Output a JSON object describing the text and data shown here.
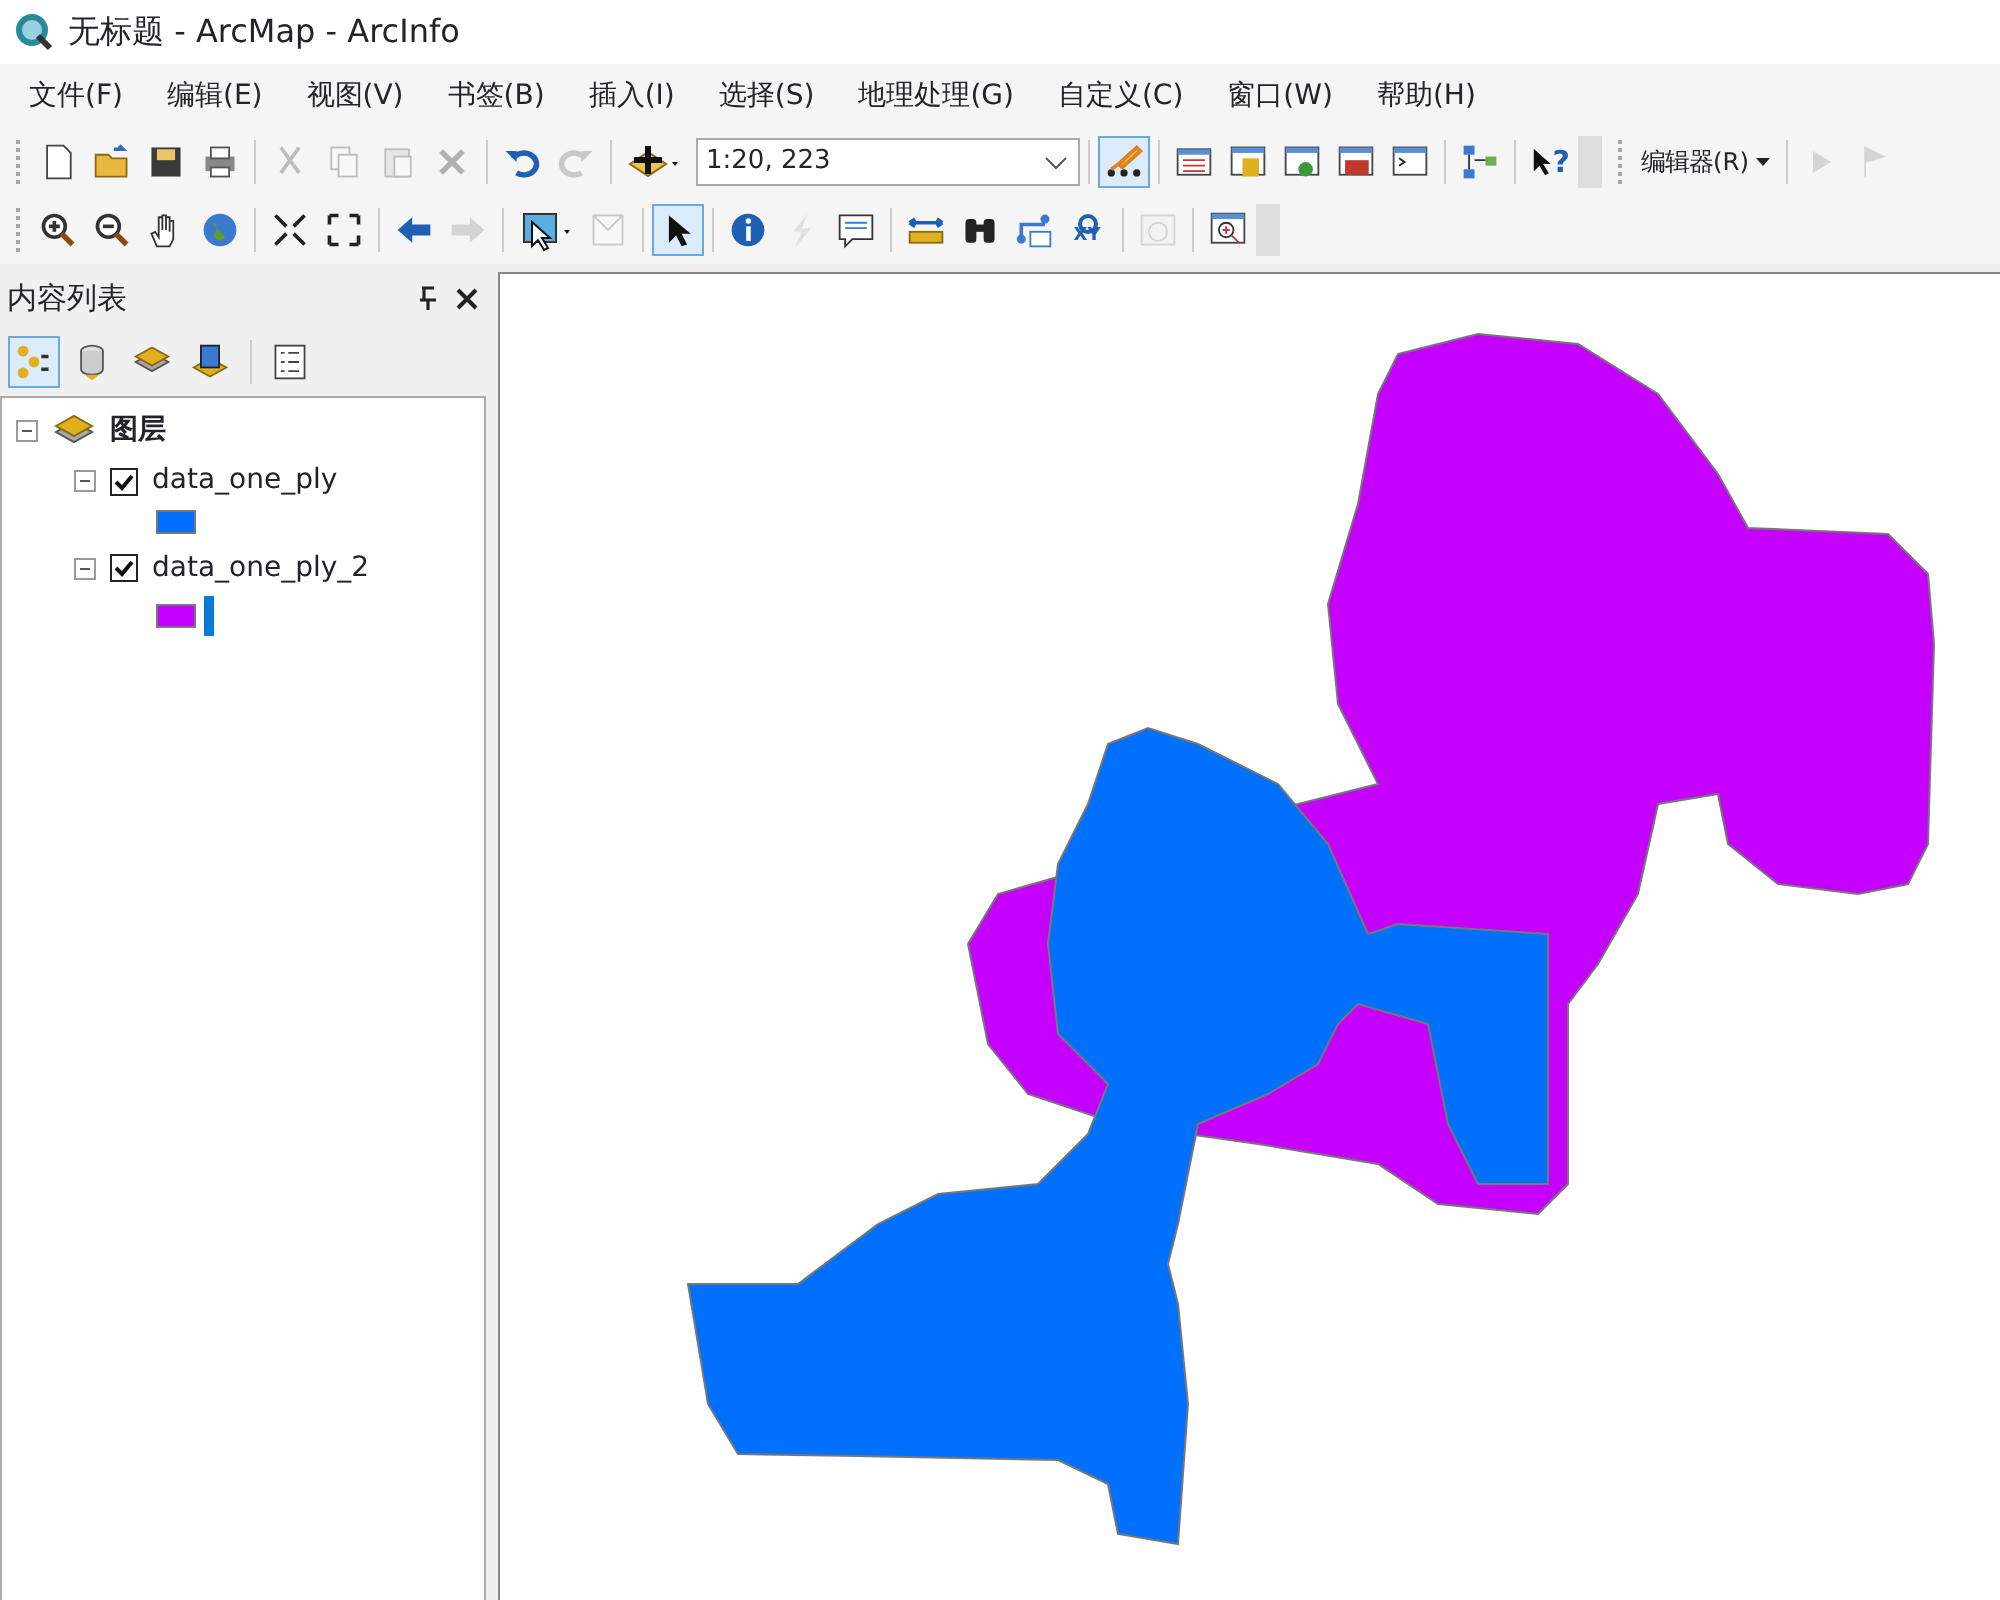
{
  "window": {
    "title": "无标题 - ArcMap - ArcInfo"
  },
  "menu": [
    "文件(F)",
    "编辑(E)",
    "视图(V)",
    "书签(B)",
    "插入(I)",
    "选择(S)",
    "地理处理(G)",
    "自定义(C)",
    "窗口(W)",
    "帮助(H)"
  ],
  "toolbar_1": [
    {
      "kind": "new",
      "disabled": false
    },
    {
      "kind": "open",
      "disabled": false
    },
    {
      "kind": "save",
      "disabled": false
    },
    {
      "kind": "print",
      "disabled": false
    },
    {
      "kind": "sep"
    },
    {
      "kind": "cut",
      "disabled": true
    },
    {
      "kind": "copy",
      "disabled": true
    },
    {
      "kind": "paste",
      "disabled": true
    },
    {
      "kind": "delete",
      "disabled": true
    },
    {
      "kind": "sep"
    },
    {
      "kind": "undo",
      "disabled": false
    },
    {
      "kind": "redo",
      "disabled": true
    },
    {
      "kind": "sep"
    },
    {
      "kind": "adddata",
      "disabled": false
    }
  ],
  "scale": {
    "value": "1:20, 223"
  },
  "toolbar_1b": [
    {
      "kind": "editor",
      "disabled": false
    },
    {
      "kind": "sep"
    },
    {
      "kind": "table",
      "disabled": false
    },
    {
      "kind": "catalog",
      "disabled": false
    },
    {
      "kind": "search",
      "disabled": false
    },
    {
      "kind": "toolbox",
      "disabled": false
    },
    {
      "kind": "python",
      "disabled": false
    },
    {
      "kind": "sep"
    },
    {
      "kind": "model",
      "disabled": false
    },
    {
      "kind": "sep"
    },
    {
      "kind": "help",
      "disabled": false,
      "label": "?"
    }
  ],
  "editor_menu": {
    "label": "编辑器(R)"
  },
  "toolbar_1c": [
    {
      "kind": "sketch",
      "disabled": true
    },
    {
      "kind": "sketchtext",
      "disabled": true
    }
  ],
  "toolbar_2": [
    {
      "kind": "zoomin",
      "disabled": false
    },
    {
      "kind": "zoomout",
      "disabled": false
    },
    {
      "kind": "pan",
      "disabled": false
    },
    {
      "kind": "globe",
      "disabled": false
    },
    {
      "kind": "sep"
    },
    {
      "kind": "fixedin",
      "disabled": false
    },
    {
      "kind": "fixedout",
      "disabled": false
    },
    {
      "kind": "sep"
    },
    {
      "kind": "back",
      "disabled": false
    },
    {
      "kind": "forward",
      "disabled": true
    },
    {
      "kind": "sep"
    },
    {
      "kind": "selectfeat",
      "disabled": false
    },
    {
      "kind": "clearsel",
      "disabled": true
    },
    {
      "kind": "sep"
    },
    {
      "kind": "pointer",
      "disabled": false
    },
    {
      "kind": "sep"
    },
    {
      "kind": "identify",
      "disabled": false
    },
    {
      "kind": "hyperlink",
      "disabled": true
    },
    {
      "kind": "popup",
      "disabled": false
    },
    {
      "kind": "sep"
    },
    {
      "kind": "measure",
      "disabled": false
    },
    {
      "kind": "find",
      "disabled": false
    },
    {
      "kind": "route",
      "disabled": false
    },
    {
      "kind": "xy",
      "disabled": false,
      "label": "XY"
    },
    {
      "kind": "sep"
    },
    {
      "kind": "time",
      "disabled": true
    },
    {
      "kind": "sep"
    },
    {
      "kind": "magnifier",
      "disabled": false
    }
  ],
  "toc": {
    "title": "内容列表",
    "tools": [
      {
        "kind": "drawing",
        "selected": true
      },
      {
        "kind": "source",
        "selected": false
      },
      {
        "kind": "visibility",
        "selected": false
      },
      {
        "kind": "selection",
        "selected": false
      },
      {
        "kind": "options",
        "selected": false
      }
    ],
    "group": {
      "label": "图层",
      "expanded": true,
      "layers": [
        {
          "name": "data_one_ply",
          "checked": true,
          "expanded": true,
          "color": "#0070ff",
          "selection_bar": false
        },
        {
          "name": "data_one_ply_2",
          "checked": true,
          "expanded": true,
          "color": "#c500ff",
          "selection_bar": true
        }
      ]
    }
  },
  "map": {
    "layers": [
      {
        "kind": "magenta-area",
        "color": "#c500ff",
        "visible": true
      },
      {
        "kind": "blue-area",
        "color": "#0070ff",
        "visible": true
      }
    ]
  }
}
